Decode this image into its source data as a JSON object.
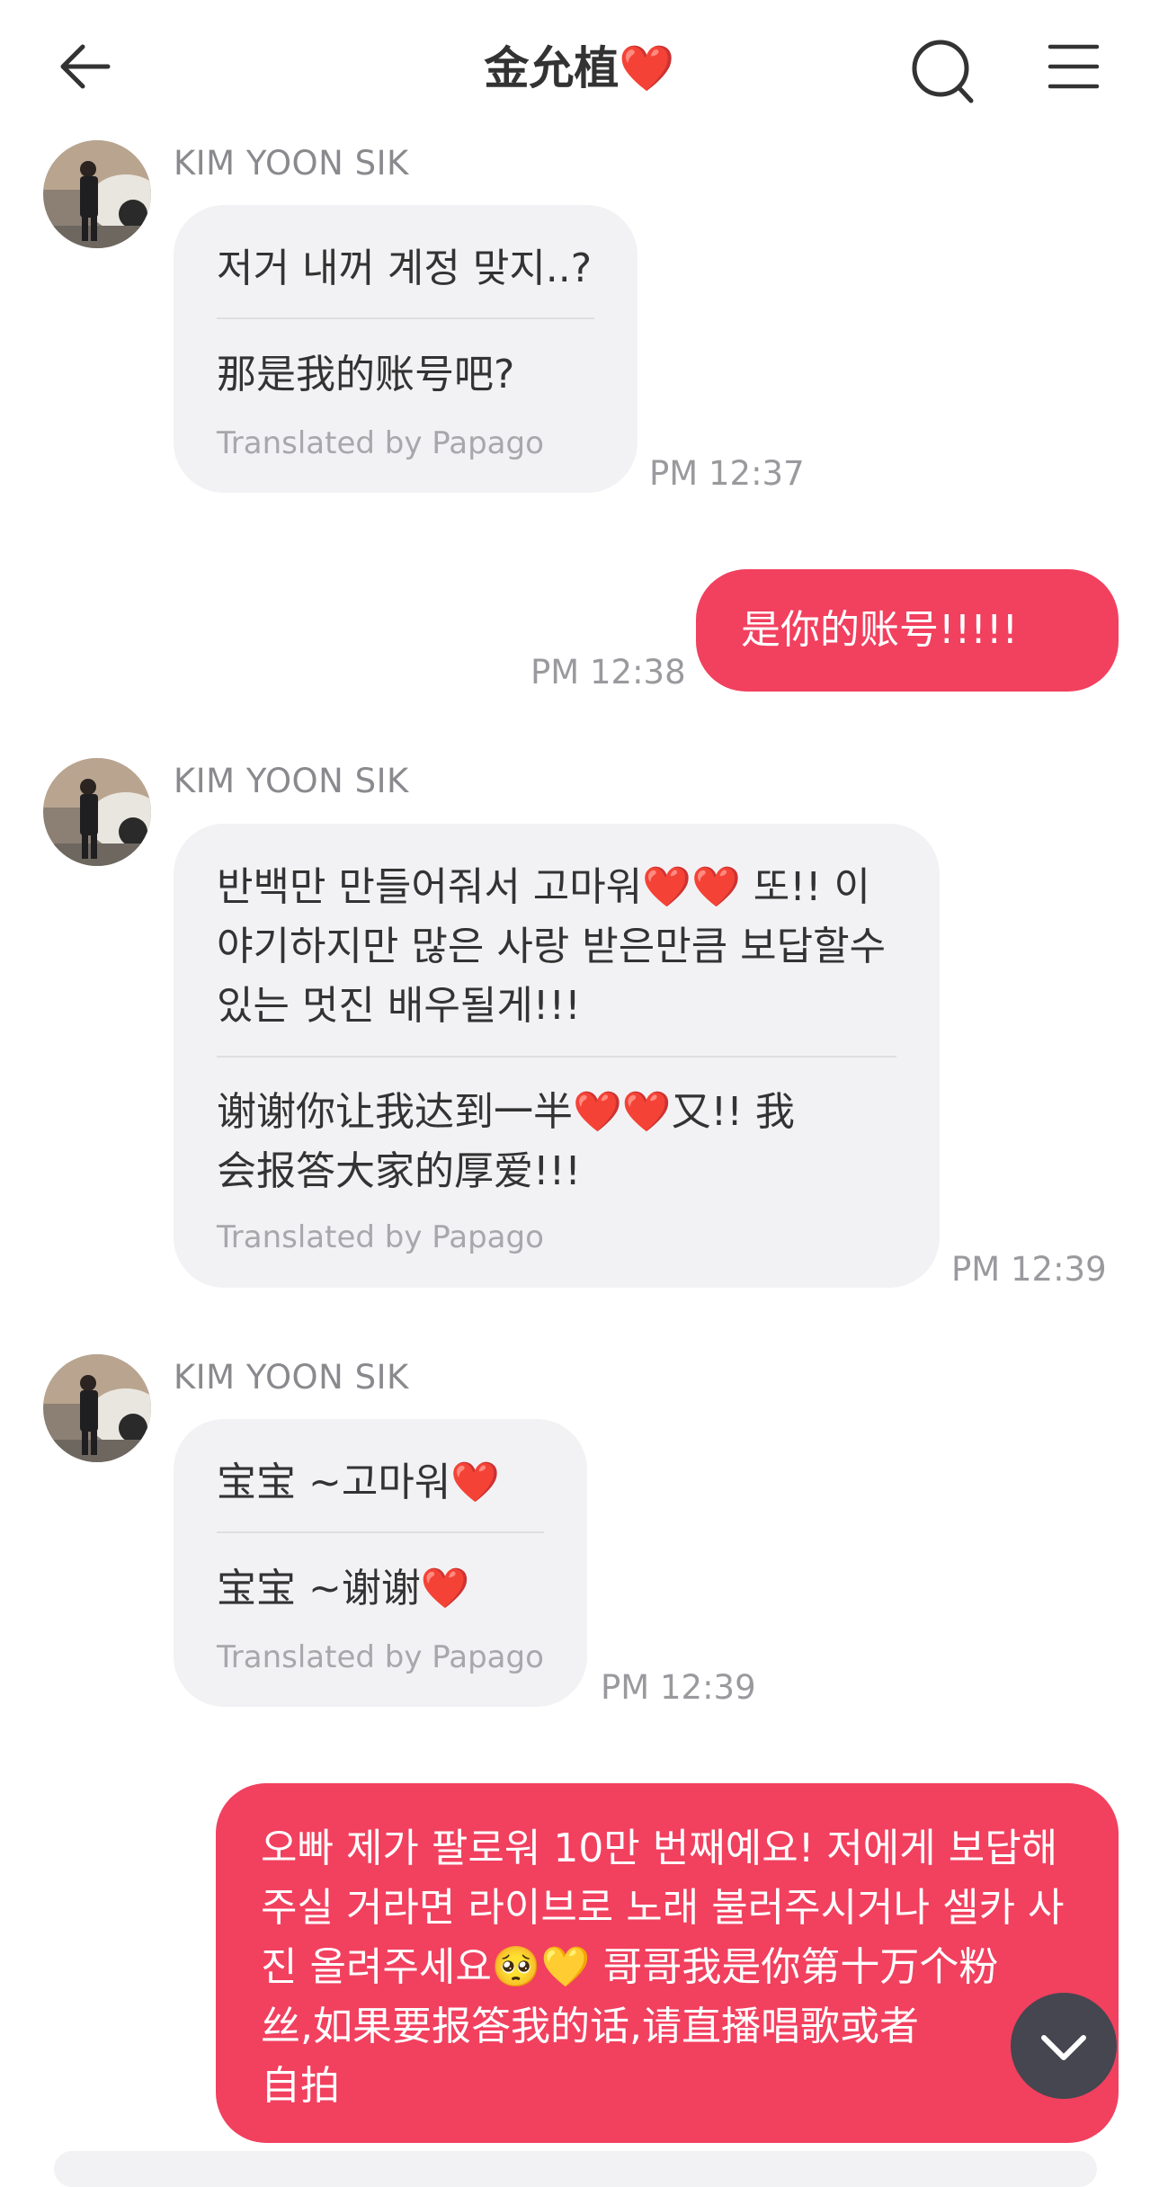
{
  "header": {
    "title": "金允植❤️",
    "back_icon": "arrow-left-icon",
    "search_icon": "search-icon",
    "menu_icon": "hamburger-menu-icon"
  },
  "colors": {
    "accent": "#f2405f",
    "bubble_in": "#f2f2f4",
    "muted": "#9a9a9e"
  },
  "messages": [
    {
      "sender": "KIM YOON SIK",
      "original": [
        "저거 내꺼 계정 맞지..?"
      ],
      "translation": [
        "那是我的账号吧?"
      ],
      "translated_by": "Translated by Papago",
      "time": "PM 12:37"
    },
    {
      "outgoing": true,
      "lines": [
        "是你的账号!!!!!"
      ],
      "time": "PM 12:38"
    },
    {
      "sender": "KIM YOON SIK",
      "original": [
        "반백만 만들어줘서 고마워❤️❤️ 또!! 이",
        "야기하지만 많은 사랑 받은만큼 보답할수",
        "있는 멋진 배우될게!!!"
      ],
      "translation": [
        "谢谢你让我达到一半❤️❤️又!!  我",
        "会报答大家的厚爱!!!"
      ],
      "translated_by": "Translated by Papago",
      "time": "PM 12:39"
    },
    {
      "sender": "KIM YOON SIK",
      "original": [
        "宝宝 ~고마워❤️"
      ],
      "translation": [
        "宝宝 ~谢谢❤️"
      ],
      "translated_by": "Translated by Papago",
      "time": "PM 12:39"
    },
    {
      "outgoing": true,
      "lines": [
        "오빠 제가 팔로워 10만 번째예요! 저에게 보답해",
        "주실 거라면 라이브로 노래 불러주시거나 셀카 사",
        "진 올려주세요🥺💛 哥哥我是你第十万个粉",
        "丝,如果要报答我的话,请直播唱歌或者",
        "自拍"
      ]
    }
  ],
  "scroll_button_icon": "chevron-down-icon"
}
